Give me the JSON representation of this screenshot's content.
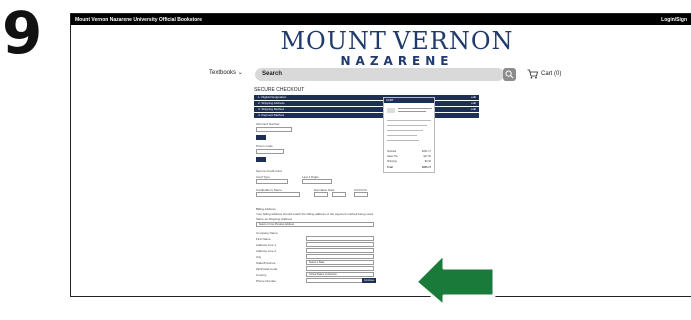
{
  "step": {
    "number": "9"
  },
  "topbar": {
    "store_name": "Mount Vernon Nazarene University Official Bookstore",
    "login": "Login/Sign"
  },
  "logo": {
    "line1_a": "MOUNT",
    "line1_b": "VERNON",
    "line2": "NAZARENE UNIVERSITY"
  },
  "nav": {
    "textbooks": "Textbooks",
    "search_placeholder": "Search",
    "cart": "Cart (0)"
  },
  "checkout": {
    "title": "SECURE CHECKOUT",
    "steps": [
      {
        "label": "1. Digital Designation",
        "edit": "edit"
      },
      {
        "label": "2. Shipping Address",
        "edit": "edit"
      },
      {
        "label": "3. Shipping Method",
        "edit": "edit"
      },
      {
        "label": "4. Payment Method",
        "edit": ""
      }
    ],
    "gift_card_label": "Gift Card Number",
    "promo_label": "Promo Code",
    "credit_card_label": "Secure Credit Card",
    "card_type_label": "Card Type",
    "card_type_value": "Visa",
    "last4_label": "Last 4 Digits",
    "cardholder_label": "Cardholder's Name",
    "expiration_label": "Expiration Date",
    "cvv_label": "CVV/CVC",
    "billing_title": "Billing Address",
    "billing_note": "Your billing address should match the billing address of the payment method being used.",
    "same_as_shipping": "Same as Shipping Address",
    "select_address": "Select or Use Previous Address",
    "fields": [
      "Company Name",
      "First Name",
      "Address Line 1",
      "Address Line 2",
      "City",
      "State/Province",
      "Zip/Postal Code",
      "Country",
      "Phone Number"
    ],
    "state_placeholder": "Select a State",
    "country_value": "United States of America",
    "continue": "Continue"
  },
  "summary": {
    "title": "CART",
    "total_label": "Total",
    "total_value": "$335.17",
    "rows": [
      "Subtotal",
      "Sales Tax",
      "Shipping"
    ],
    "values": [
      "$331.17",
      "$17.00",
      "$0.00"
    ]
  },
  "colors": {
    "navy": "#1e2f55",
    "logo": "#1f3a6b",
    "arrow": "#1a7a3a"
  }
}
